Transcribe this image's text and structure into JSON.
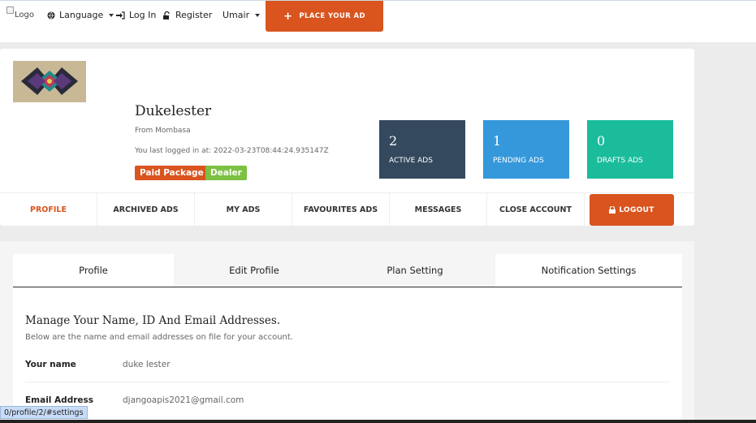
{
  "topnav": {
    "logo_alt": "Logo",
    "language": "Language",
    "login": "Log In",
    "register": "Register",
    "user": "Umair",
    "place_ad": "PLACE YOUR AD"
  },
  "profile": {
    "name": "Dukelester",
    "from": "From  Mombasa",
    "last_logged": "You last logged in at:  2022-03-23T08:44:24.935147Z",
    "badges": [
      "Paid Package",
      "Dealer"
    ]
  },
  "stats": [
    {
      "value": "2",
      "label": "ACTIVE ADS",
      "color": "#34495e"
    },
    {
      "value": "1",
      "label": "PENDING ADS",
      "color": "#3498db"
    },
    {
      "value": "0",
      "label": "DRAFTS ADS",
      "color": "#1abc9c"
    }
  ],
  "tabs": [
    "PROFILE",
    "ARCHIVED ADS",
    "MY ADS",
    "FAVOURITES ADS",
    "MESSAGES",
    "CLOSE ACCOUNT"
  ],
  "logout": "LOGOUT",
  "settings_tabs": [
    "Profile",
    "Edit Profile",
    "Plan Setting",
    "Notification Settings"
  ],
  "settings": {
    "heading": "Manage Your Name, ID And Email Addresses.",
    "subheading": "Below are the name and email addresses on file for your account.",
    "fields": [
      {
        "label": "Your name",
        "value": "duke lester"
      },
      {
        "label": "Email Address",
        "value": "djangoapis2021@gmail.com"
      }
    ]
  },
  "status_url": "0/profile/2/#settings",
  "colors": {
    "accent": "#d9541e",
    "dealer": "#7cc142"
  }
}
